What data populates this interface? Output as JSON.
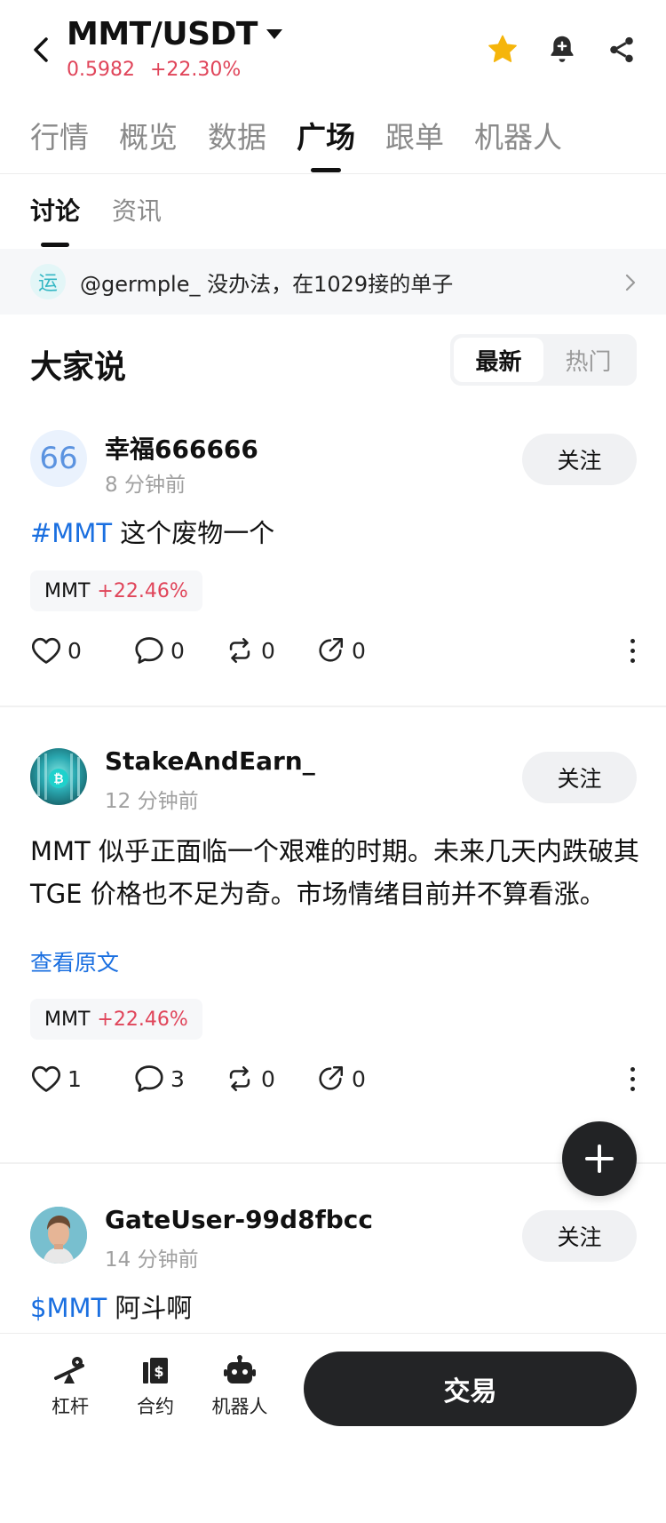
{
  "header": {
    "pair": "MMT/USDT",
    "price": "0.5982",
    "change": "+22.30%",
    "colors": {
      "up": "#e0455a",
      "star": "#f5b50b",
      "link": "#1a6fe0"
    },
    "icons": [
      "back-arrow-icon",
      "star-icon",
      "bell-plus-icon",
      "share-icon"
    ]
  },
  "main_tabs": [
    "行情",
    "概览",
    "数据",
    "广场",
    "跟单",
    "机器人"
  ],
  "main_tab_active": "广场",
  "sub_tabs": [
    "讨论",
    "资讯"
  ],
  "sub_tab_active": "讨论",
  "announcement": {
    "badge": "运",
    "text": "@germple_ 没办法，在1029接的单子"
  },
  "feed": {
    "title": "大家说",
    "sort_options": [
      "最新",
      "热门"
    ],
    "sort_active": "最新"
  },
  "posts": [
    {
      "avatar_text": "66",
      "username": "幸福666666",
      "time": "8 分钟前",
      "follow": "关注",
      "tag": "#MMT",
      "text": " 这个废物一个",
      "chip": {
        "symbol": "MMT",
        "change": "+22.46%"
      },
      "likes": "0",
      "comments": "0",
      "reposts": "0",
      "shares": "0"
    },
    {
      "username": "StakeAndEarn_",
      "time": "12 分钟前",
      "follow": "关注",
      "text": "MMT 似乎正面临一个艰难的时期。未来几天内跌破其 TGE 价格也不足为奇。市场情绪目前并不算看涨。",
      "readmore": "查看原文",
      "chip": {
        "symbol": "MMT",
        "change": "+22.46%"
      },
      "likes": "1",
      "comments": "3",
      "reposts": "0",
      "shares": "0"
    },
    {
      "username": "GateUser-99d8fbcc",
      "time": "14 分钟前",
      "follow": "关注",
      "tag": "$MMT",
      "text": " 阿斗啊"
    }
  ],
  "bottom_bar": {
    "items": [
      "杠杆",
      "合约",
      "机器人"
    ],
    "trade": "交易"
  }
}
